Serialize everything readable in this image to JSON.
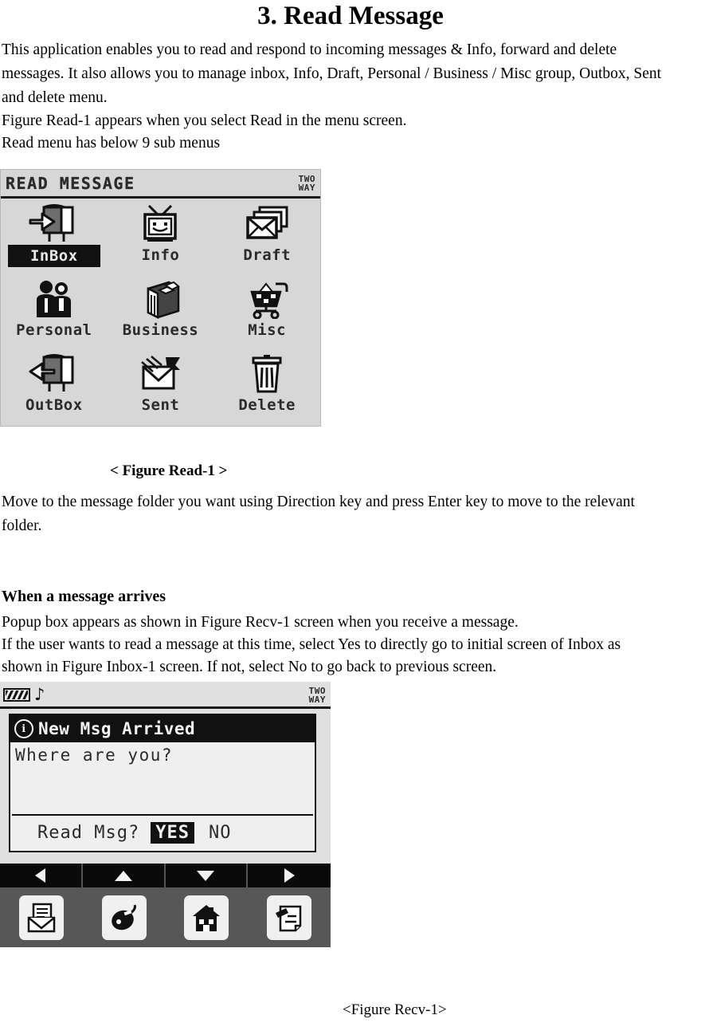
{
  "document": {
    "title": "3. Read Message",
    "paragraphs": [
      "This application enables you to read and respond to incoming messages & Info, forward and delete",
      "messages. It also allows you to manage inbox, Info, Draft, Personal / Business / Misc group, Outbox, Sent",
      "and delete menu.",
      "Figure Read-1 appears when you select Read in the menu screen.",
      "Read menu has below 9 sub menus"
    ],
    "figure1_caption": "< Figure Read-1 >",
    "after_figure1": [
      "Move to the message folder you want using Direction key and press Enter key to move to the relevant",
      "folder."
    ],
    "section_heading": "When a message arrives",
    "section_paragraphs": [
      "Popup box appears as shown in Figure Recv-1 screen when you receive a message.",
      "If the user wants to read a message at this time, select Yes to directly go to initial screen of Inbox as",
      "shown in Figure Inbox-1 screen. If not, select No to go back to previous screen."
    ],
    "figure2_caption": "<Figure Recv-1>"
  },
  "figure1": {
    "screen_title": "READ MESSAGE",
    "badge_line1": "TWO",
    "badge_line2": "WAY",
    "menu_items": [
      {
        "label": "InBox",
        "icon": "inbox-tray-icon",
        "selected": true
      },
      {
        "label": "Info",
        "icon": "tv-info-icon",
        "selected": false
      },
      {
        "label": "Draft",
        "icon": "envelope-stack-icon",
        "selected": false
      },
      {
        "label": "Personal",
        "icon": "two-people-icon",
        "selected": false
      },
      {
        "label": "Business",
        "icon": "file-box-icon",
        "selected": false
      },
      {
        "label": "Misc",
        "icon": "shopping-cart-icon",
        "selected": false
      },
      {
        "label": "OutBox",
        "icon": "outbox-tray-icon",
        "selected": false
      },
      {
        "label": "Sent",
        "icon": "flying-envelope-icon",
        "selected": false
      },
      {
        "label": "Delete",
        "icon": "trash-can-icon",
        "selected": false
      }
    ],
    "colors": {
      "screen_bg": "#d7d7d7",
      "ink": "#2b2b2b",
      "highlight_bg": "#111111",
      "highlight_fg": "#e8e8e8"
    }
  },
  "figure2": {
    "badge_line1": "TWO",
    "badge_line2": "WAY",
    "status_icons": [
      "battery-icon",
      "music-note-icon"
    ],
    "music_note": "♪",
    "popup": {
      "info_glyph": "i",
      "header": "New Msg Arrived",
      "message": "Where are you?",
      "prompt": "Read Msg?",
      "yes_label": "YES",
      "no_label": "NO",
      "selected_option": "YES"
    },
    "nav_arrows": [
      "left-arrow-icon",
      "up-arrow-icon",
      "down-arrow-icon",
      "right-arrow-icon"
    ],
    "softkeys": [
      "read-mail-icon",
      "pager-icon",
      "home-icon",
      "compose-icon"
    ],
    "colors": {
      "screen_bg": "#e0e0e0",
      "navbar_bg": "#0a0a0a",
      "softbar_bg": "#575757",
      "key_bg": "#f0f0f0"
    }
  }
}
